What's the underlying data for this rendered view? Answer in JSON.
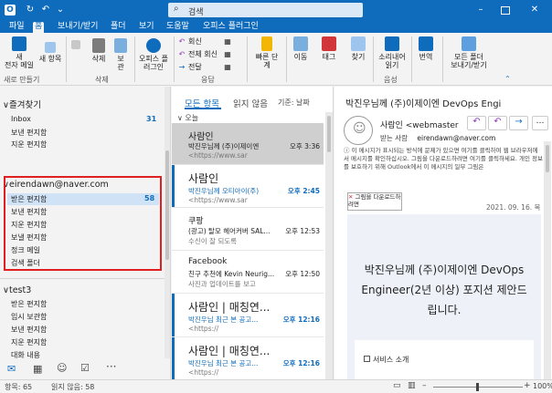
{
  "title_bar": {
    "search_placeholder": "검색"
  },
  "menu_tabs": [
    "파일",
    "홈",
    "보내기/받기",
    "폴더",
    "보기",
    "도움말",
    "오피스 플러그인"
  ],
  "ribbon": {
    "new_email": "새\n전자 메일",
    "new_items": "새 항목",
    "delete": "삭제",
    "archive": "보\n관",
    "office_plugin": "오피스 플\n러그인",
    "reply": "회신",
    "reply_all": "전체 회신",
    "forward": "전달",
    "quick_steps": "빠른 단\n계",
    "move": "이동",
    "tags": "태그",
    "find": "찾기",
    "read_aloud": "소리내어\n읽기",
    "translate": "번역",
    "send_receive": "모든 폴더\n보내기/받기",
    "groups": [
      "새로 만들기",
      "삭제",
      "",
      "응답",
      "",
      "",
      "",
      "음성",
      "",
      "",
      "보내기/받기"
    ]
  },
  "nav": {
    "favorites": "즐겨찾기",
    "fav_items": [
      {
        "label": "Inbox",
        "count": "31"
      },
      {
        "label": "보낸 편지함",
        "count": ""
      },
      {
        "label": "지운 편지함",
        "count": ""
      }
    ],
    "account1": "eirendawn@naver.com",
    "acc1_items": [
      {
        "label": "받은 편지함",
        "count": "58"
      },
      {
        "label": "보낸 편지함",
        "count": ""
      },
      {
        "label": "지운 편지함",
        "count": ""
      },
      {
        "label": "보낼 편지함",
        "count": ""
      },
      {
        "label": "정크 메일",
        "count": ""
      },
      {
        "label": "검색 폴더",
        "count": ""
      }
    ],
    "account2": "test3",
    "acc2_items": [
      {
        "label": "받은 편지함",
        "count": ""
      },
      {
        "label": "임시 보관함",
        "count": ""
      },
      {
        "label": "보낸 편지함",
        "count": ""
      },
      {
        "label": "지운 편지함",
        "count": ""
      },
      {
        "label": "대화 내용",
        "count": ""
      }
    ]
  },
  "list": {
    "tab_all": "모든 항목",
    "tab_unread": "읽지 않음",
    "sort": "기준: 날짜",
    "group_today": "오늘",
    "messages": [
      {
        "from": "사람인",
        "subject": "박진우님께 (주)이제이엔",
        "preview": "<https://www.sar",
        "time": "오후 3:36",
        "unread": false
      },
      {
        "from": "사람인",
        "subject": "박진우님께 오티아이(주)",
        "preview": "<https://www.sar",
        "time": "오후 2:45",
        "unread": true
      },
      {
        "from": "쿠팡",
        "subject": "(광고) 탈모 헤어커버 SAL...",
        "preview": "수신이 잘 되도록",
        "time": "오후 12:53",
        "unread": false
      },
      {
        "from": "Facebook",
        "subject": "친구 추천에 Kevin Neurig...",
        "preview": "사진과 업데이트를 보고",
        "time": "오후 12:50",
        "unread": false
      },
      {
        "from": "사람인 | 매칭연...",
        "subject": "박진우님 최근 본 공고...",
        "preview": "<https://",
        "time": "오후 12:16",
        "unread": true
      },
      {
        "from": "사람인 | 매칭연...",
        "subject": "박진우님 최근 본 공고...",
        "preview": "<https://",
        "time": "오후 12:16",
        "unread": true
      }
    ]
  },
  "reading": {
    "subject": "박진우님께 (주)이제이엔 DevOps Engi",
    "sender": "사람인 <webmaster",
    "recipient_label": "받는 사람",
    "recipient": "eirendawn@naver.com",
    "info": "이 메시지가 표시되는 방식에 문제가 있으면 여기를 클릭하여 웹 브라우저에서 메시지를 확인하십시오. 그림을 다운로드하려면 여기를 클릭하세요. 개인 정보를 보호하기 위해 Outlook에서 이 메시지의 일부 그림은",
    "image_label": "그림을 다운로드하려면",
    "date": "2021. 09. 16. 목",
    "body_title": "박진우님께 (주)이제이엔 DevOps Engineer(2년 이상) 포지션 제안드립니다.",
    "service_intro": "서비스 소개"
  },
  "status": {
    "items": "항목: 65",
    "unread": "읽지 않음: 58",
    "zoom": "100%"
  },
  "colors": {
    "accent": "#0f6cbd",
    "highlight": "#e02020"
  }
}
